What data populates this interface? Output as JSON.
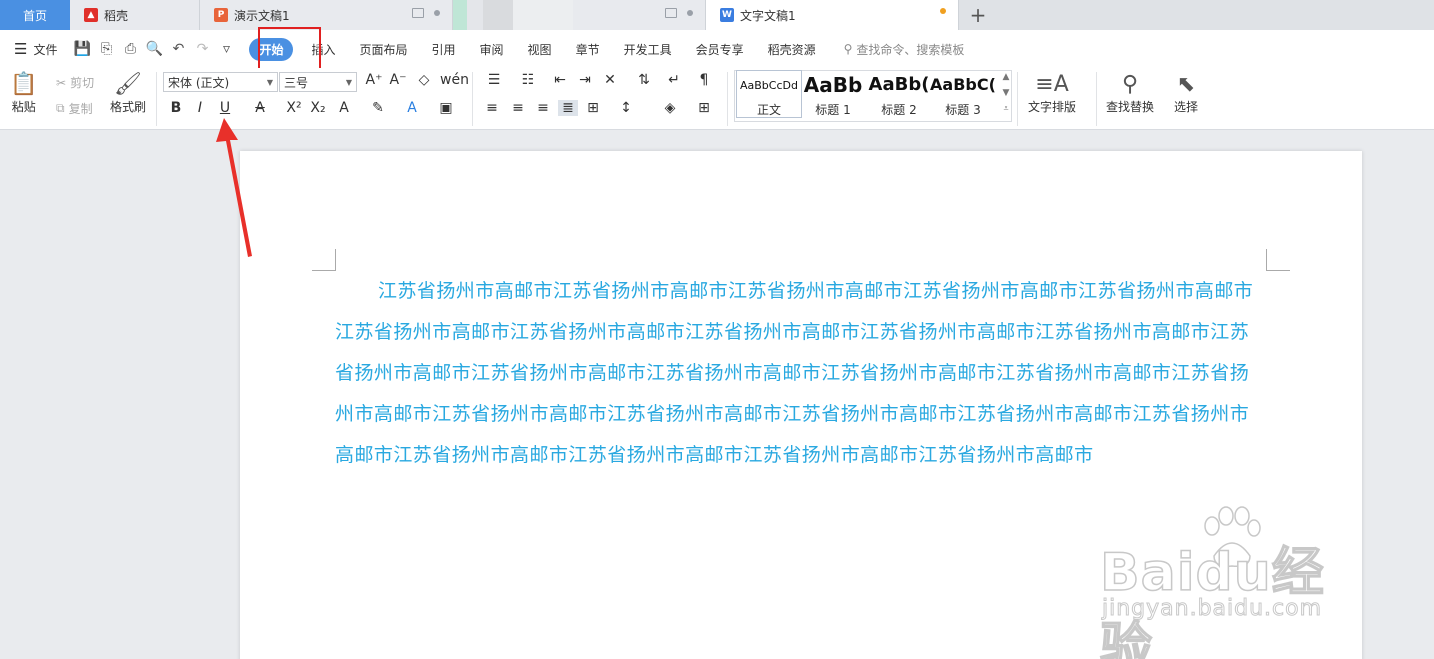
{
  "tabs": {
    "home": "首页",
    "daoke": "稻壳",
    "ppt": "演示文稿1",
    "doc": "文字文稿1",
    "plus": "+"
  },
  "menu": {
    "file": "文件",
    "items": [
      "开始",
      "插入",
      "页面布局",
      "引用",
      "审阅",
      "视图",
      "章节",
      "开发工具",
      "会员专享",
      "稻壳资源"
    ],
    "search_placeholder": "查找命令、搜索模板"
  },
  "ribbon": {
    "paste": "粘贴",
    "cut": "剪切",
    "copy": "复制",
    "format_painter": "格式刷",
    "font_name": "宋体 (正文)",
    "font_size": "三号",
    "styles": [
      {
        "sample": "AaBbCcDd",
        "name": "正文"
      },
      {
        "sample": "AaBb",
        "name": "标题 1"
      },
      {
        "sample": "AaBb(",
        "name": "标题 2"
      },
      {
        "sample": "AaBbC(",
        "name": "标题 3"
      }
    ],
    "text_layout": "文字排版",
    "find_replace": "查找替换",
    "select": "选择"
  },
  "document": {
    "body": "江苏省扬州市高邮市江苏省扬州市高邮市江苏省扬州市高邮市江苏省扬州市高邮市江苏省扬州市高邮市江苏省扬州市高邮市江苏省扬州市高邮市江苏省扬州市高邮市江苏省扬州市高邮市江苏省扬州市高邮市江苏省扬州市高邮市江苏省扬州市高邮市江苏省扬州市高邮市江苏省扬州市高邮市江苏省扬州市高邮市江苏省扬州市高邮市江苏省扬州市高邮市江苏省扬州市高邮市江苏省扬州市高邮市江苏省扬州市高邮市江苏省扬州市高邮市江苏省扬州市高邮市江苏省扬州市高邮市江苏省扬州市高邮市江苏省扬州市高邮市"
  },
  "watermark": {
    "logo": "Baidu经验",
    "url": "jingyan.baidu.com"
  },
  "colors": {
    "accent": "#4a90e2",
    "text_blue": "#29a8e0",
    "annotation_red": "#e02020"
  }
}
